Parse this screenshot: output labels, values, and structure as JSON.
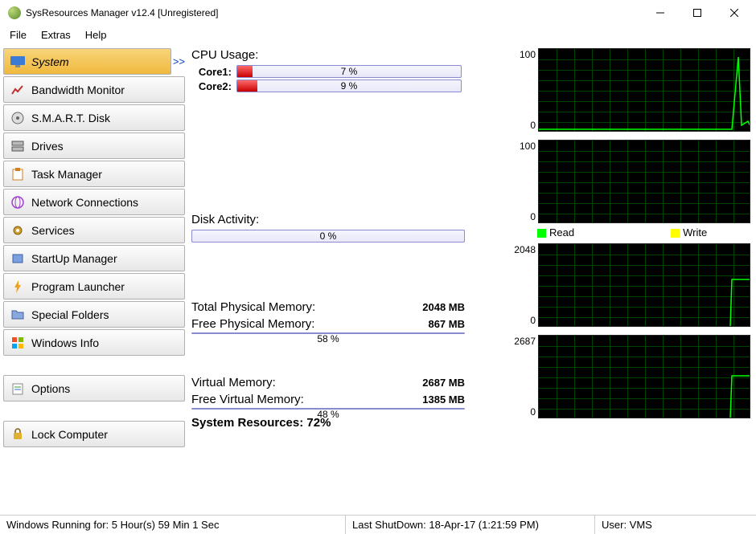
{
  "window": {
    "title": "SysResources Manager  v12.4 [Unregistered]"
  },
  "menu": {
    "file": "File",
    "extras": "Extras",
    "help": "Help"
  },
  "sidebar": {
    "items": [
      {
        "label": "System"
      },
      {
        "label": "Bandwidth Monitor"
      },
      {
        "label": "S.M.A.R.T. Disk"
      },
      {
        "label": "Drives"
      },
      {
        "label": "Task Manager"
      },
      {
        "label": "Network Connections"
      },
      {
        "label": "Services"
      },
      {
        "label": "StartUp Manager"
      },
      {
        "label": "Program Launcher"
      },
      {
        "label": "Special Folders"
      },
      {
        "label": "Windows Info"
      }
    ],
    "options": "Options",
    "lock": "Lock Computer"
  },
  "cpu": {
    "title": "CPU Usage:",
    "core1_label": "Core1:",
    "core1_pct": "7 %",
    "core1_fill": 7,
    "core2_label": "Core2:",
    "core2_pct": "9 %",
    "core2_fill": 9,
    "ymax": "100",
    "ymin": "0"
  },
  "disk": {
    "title": "Disk Activity:",
    "pct": "0 %",
    "fill": 0,
    "ymax": "100",
    "ymin": "0",
    "legend_read": "Read",
    "legend_write": "Write"
  },
  "mem": {
    "total_label": "Total Physical Memory:",
    "total_value": "2048 MB",
    "free_label": "Free Physical Memory:",
    "free_value": "867 MB",
    "pct": "58 %",
    "fill": 58,
    "ymax": "2048",
    "ymin": "0"
  },
  "vmem": {
    "total_label": "Virtual Memory:",
    "total_value": "2687 MB",
    "free_label": "Free Virtual Memory:",
    "free_value": "1385 MB",
    "pct": "48 %",
    "fill": 48,
    "ymax": "2687",
    "ymin": "0"
  },
  "sysres": {
    "label": "System Resources: 72%"
  },
  "status": {
    "uptime": "Windows Running for: 5 Hour(s) 59 Min 1 Sec",
    "shutdown": "Last ShutDown: 18-Apr-17 (1:21:59 PM)",
    "user": "User: VMS"
  },
  "arrow": ">>"
}
